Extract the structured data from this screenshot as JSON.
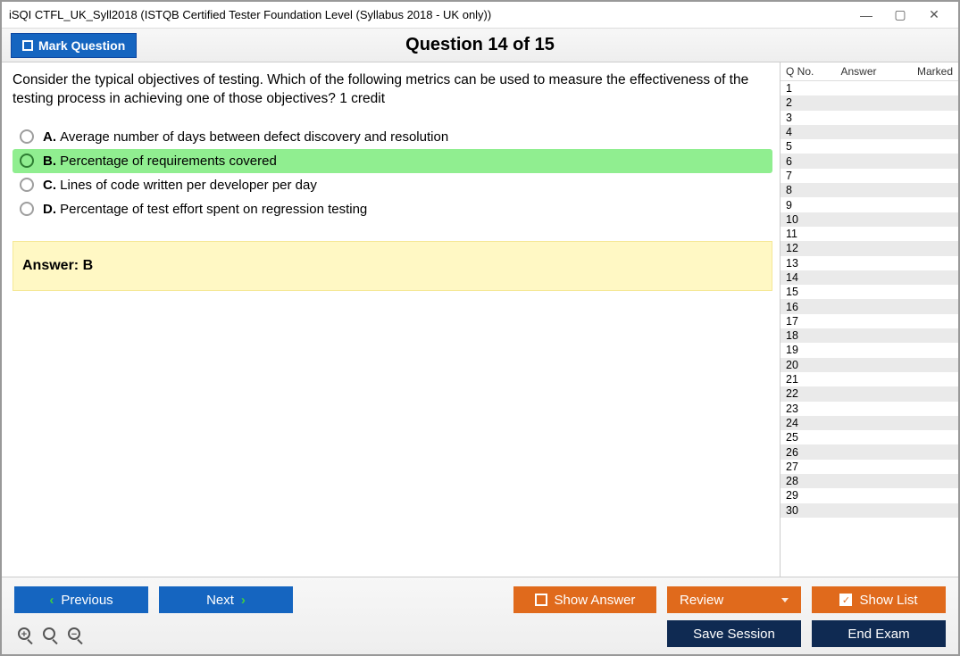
{
  "window": {
    "title": "iSQI CTFL_UK_Syll2018 (ISTQB Certified Tester Foundation Level (Syllabus 2018 - UK only))"
  },
  "header": {
    "mark_label": "Mark Question",
    "question_title": "Question 14 of 15"
  },
  "question": {
    "text": "Consider the typical objectives of testing. Which of the following metrics can be used to measure the effectiveness of the testing process in achieving one of those objectives? 1 credit",
    "options": [
      {
        "letter": "A.",
        "text": "Average number of days between defect discovery and resolution",
        "highlight": false
      },
      {
        "letter": "B.",
        "text": "Percentage of requirements covered",
        "highlight": true
      },
      {
        "letter": "C.",
        "text": "Lines of code written per developer per day",
        "highlight": false
      },
      {
        "letter": "D.",
        "text": "Percentage of test effort spent on regression testing",
        "highlight": false
      }
    ],
    "answer_label": "Answer: B"
  },
  "sidebar": {
    "headers": {
      "qno": "Q No.",
      "answer": "Answer",
      "marked": "Marked"
    },
    "row_count": 30
  },
  "footer": {
    "previous": "Previous",
    "next": "Next",
    "show_answer": "Show Answer",
    "review": "Review",
    "show_list": "Show List",
    "save_session": "Save Session",
    "end_exam": "End Exam"
  }
}
